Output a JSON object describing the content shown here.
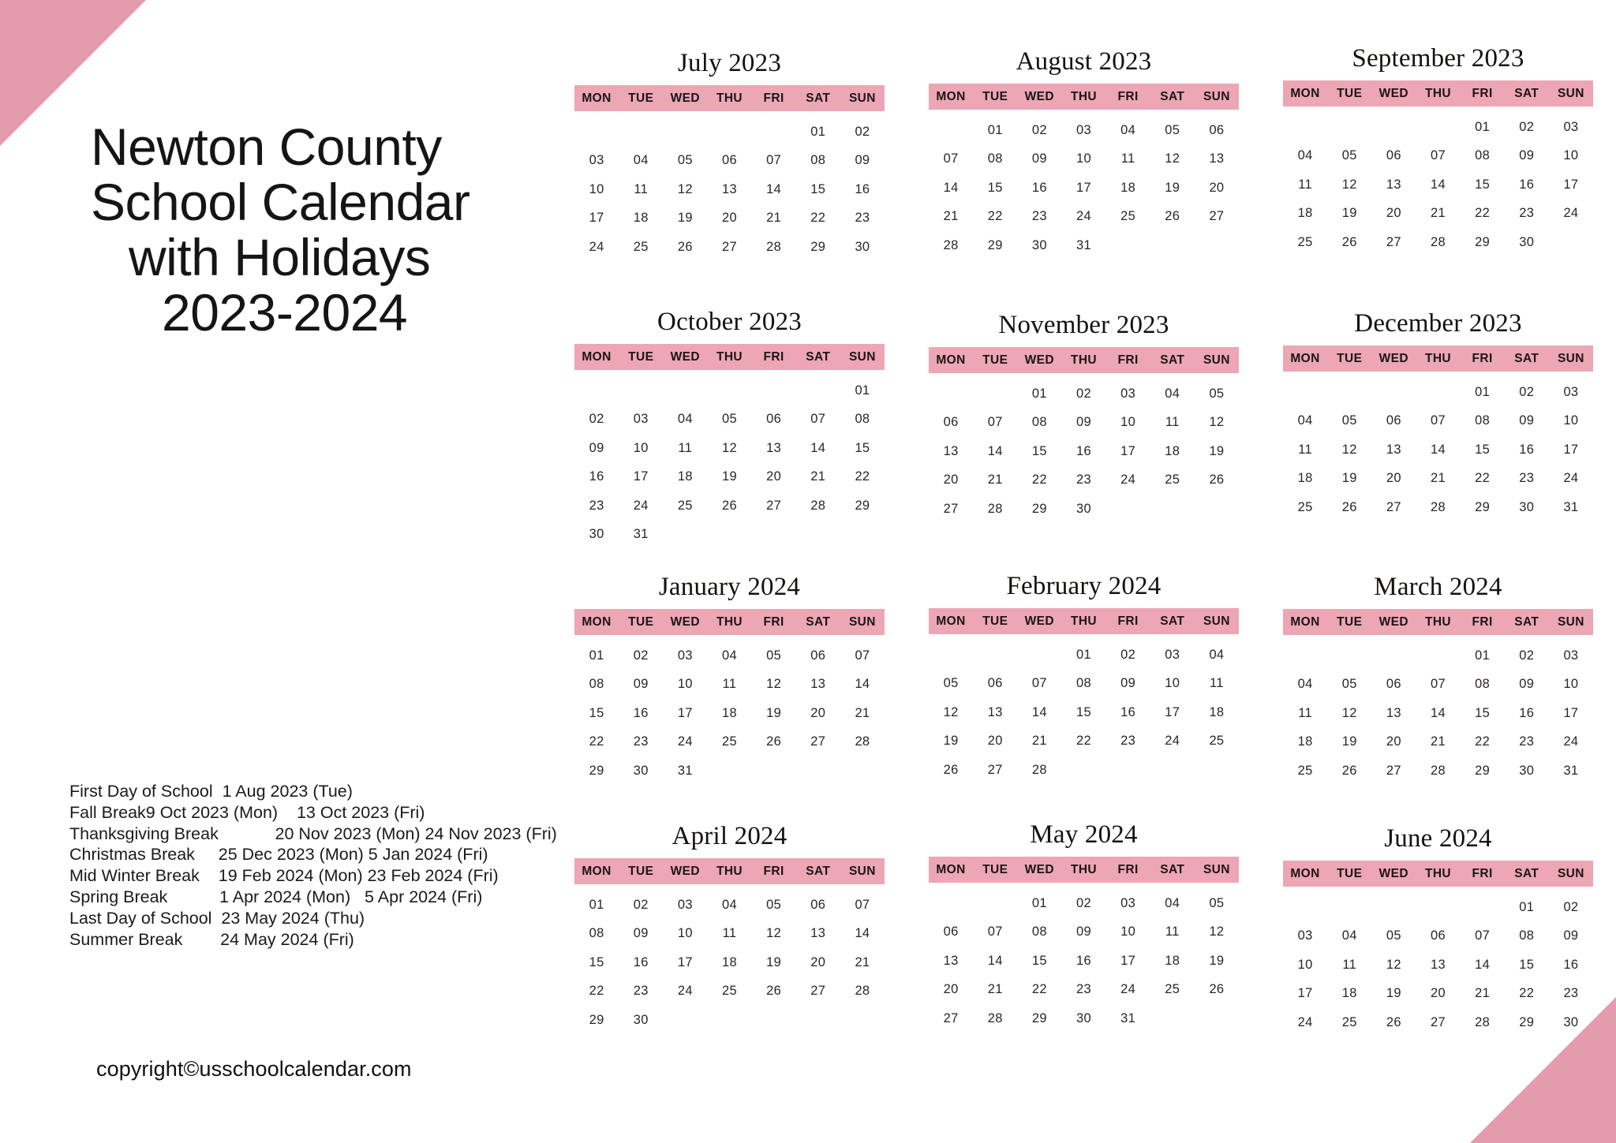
{
  "theme": {
    "accent_pink": "#e49bac",
    "header_pink": "#eda6b4",
    "text_dark": "#151515",
    "background": "#ffffff"
  },
  "title": {
    "line1": "Newton County",
    "line2": "School Calendar",
    "line3": "with Holidays",
    "line4": "2023-2024"
  },
  "holidays": [
    "First Day of School  1 Aug 2023 (Tue)",
    "Fall Break9 Oct 2023 (Mon)    13 Oct 2023 (Fri)",
    "Thanksgiving Break            20 Nov 2023 (Mon) 24 Nov 2023 (Fri)",
    "Christmas Break     25 Dec 2023 (Mon) 5 Jan 2024 (Fri)",
    "Mid Winter Break    19 Feb 2024 (Mon) 23 Feb 2024 (Fri)",
    "Spring Break           1 Apr 2024 (Mon)   5 Apr 2024 (Fri)",
    "Last Day of School  23 May 2024 (Thu)",
    "Summer Break        24 May 2024 (Fri)"
  ],
  "copyright": "copyright©usschoolcalendar.com",
  "weekday_headers": [
    "MON",
    "TUE",
    "WED",
    "THU",
    "FRI",
    "SAT",
    "SUN"
  ],
  "months": [
    {
      "key": "jul",
      "title": "July 2023",
      "weeks": [
        [
          "",
          "",
          "",
          "",
          "",
          "01",
          "02"
        ],
        [
          "03",
          "04",
          "05",
          "06",
          "07",
          "08",
          "09"
        ],
        [
          "10",
          "11",
          "12",
          "13",
          "14",
          "15",
          "16"
        ],
        [
          "17",
          "18",
          "19",
          "20",
          "21",
          "22",
          "23"
        ],
        [
          "24",
          "25",
          "26",
          "27",
          "28",
          "29",
          "30"
        ]
      ]
    },
    {
      "key": "aug",
      "title": "August 2023",
      "weeks": [
        [
          "",
          "01",
          "02",
          "03",
          "04",
          "05",
          "06"
        ],
        [
          "07",
          "08",
          "09",
          "10",
          "11",
          "12",
          "13"
        ],
        [
          "14",
          "15",
          "16",
          "17",
          "18",
          "19",
          "20"
        ],
        [
          "21",
          "22",
          "23",
          "24",
          "25",
          "26",
          "27"
        ],
        [
          "28",
          "29",
          "30",
          "31",
          "",
          "",
          ""
        ]
      ]
    },
    {
      "key": "sep",
      "title": "September 2023",
      "weeks": [
        [
          "",
          "",
          "",
          "",
          "01",
          "02",
          "03"
        ],
        [
          "04",
          "05",
          "06",
          "07",
          "08",
          "09",
          "10"
        ],
        [
          "11",
          "12",
          "13",
          "14",
          "15",
          "16",
          "17"
        ],
        [
          "18",
          "19",
          "20",
          "21",
          "22",
          "23",
          "24"
        ],
        [
          "25",
          "26",
          "27",
          "28",
          "29",
          "30",
          ""
        ]
      ]
    },
    {
      "key": "oct",
      "title": "October 2023",
      "weeks": [
        [
          "",
          "",
          "",
          "",
          "",
          "",
          "01"
        ],
        [
          "02",
          "03",
          "04",
          "05",
          "06",
          "07",
          "08"
        ],
        [
          "09",
          "10",
          "11",
          "12",
          "13",
          "14",
          "15"
        ],
        [
          "16",
          "17",
          "18",
          "19",
          "20",
          "21",
          "22"
        ],
        [
          "23",
          "24",
          "25",
          "26",
          "27",
          "28",
          "29"
        ],
        [
          "30",
          "31",
          "",
          "",
          "",
          "",
          ""
        ]
      ]
    },
    {
      "key": "nov",
      "title": "November 2023",
      "weeks": [
        [
          "",
          "",
          "01",
          "02",
          "03",
          "04",
          "05"
        ],
        [
          "06",
          "07",
          "08",
          "09",
          "10",
          "11",
          "12"
        ],
        [
          "13",
          "14",
          "15",
          "16",
          "17",
          "18",
          "19"
        ],
        [
          "20",
          "21",
          "22",
          "23",
          "24",
          "25",
          "26"
        ],
        [
          "27",
          "28",
          "29",
          "30",
          "",
          "",
          ""
        ]
      ]
    },
    {
      "key": "dec",
      "title": "December 2023",
      "weeks": [
        [
          "",
          "",
          "",
          "",
          "01",
          "02",
          "03"
        ],
        [
          "04",
          "05",
          "06",
          "07",
          "08",
          "09",
          "10"
        ],
        [
          "11",
          "12",
          "13",
          "14",
          "15",
          "16",
          "17"
        ],
        [
          "18",
          "19",
          "20",
          "21",
          "22",
          "23",
          "24"
        ],
        [
          "25",
          "26",
          "27",
          "28",
          "29",
          "30",
          "31"
        ]
      ]
    },
    {
      "key": "jan",
      "title": "January 2024",
      "weeks": [
        [
          "01",
          "02",
          "03",
          "04",
          "05",
          "06",
          "07"
        ],
        [
          "08",
          "09",
          "10",
          "11",
          "12",
          "13",
          "14"
        ],
        [
          "15",
          "16",
          "17",
          "18",
          "19",
          "20",
          "21"
        ],
        [
          "22",
          "23",
          "24",
          "25",
          "26",
          "27",
          "28"
        ],
        [
          "29",
          "30",
          "31",
          "",
          "",
          "",
          ""
        ]
      ]
    },
    {
      "key": "feb",
      "title": "February 2024",
      "weeks": [
        [
          "",
          "",
          "",
          "01",
          "02",
          "03",
          "04"
        ],
        [
          "05",
          "06",
          "07",
          "08",
          "09",
          "10",
          "11"
        ],
        [
          "12",
          "13",
          "14",
          "15",
          "16",
          "17",
          "18"
        ],
        [
          "19",
          "20",
          "21",
          "22",
          "23",
          "24",
          "25"
        ],
        [
          "26",
          "27",
          "28",
          "",
          "",
          "",
          ""
        ]
      ]
    },
    {
      "key": "mar",
      "title": "March 2024",
      "weeks": [
        [
          "",
          "",
          "",
          "",
          "01",
          "02",
          "03"
        ],
        [
          "04",
          "05",
          "06",
          "07",
          "08",
          "09",
          "10"
        ],
        [
          "11",
          "12",
          "13",
          "14",
          "15",
          "16",
          "17"
        ],
        [
          "18",
          "19",
          "20",
          "21",
          "22",
          "23",
          "24"
        ],
        [
          "25",
          "26",
          "27",
          "28",
          "29",
          "30",
          "31"
        ]
      ]
    },
    {
      "key": "apr",
      "title": "April 2024",
      "weeks": [
        [
          "01",
          "02",
          "03",
          "04",
          "05",
          "06",
          "07"
        ],
        [
          "08",
          "09",
          "10",
          "11",
          "12",
          "13",
          "14"
        ],
        [
          "15",
          "16",
          "17",
          "18",
          "19",
          "20",
          "21"
        ],
        [
          "22",
          "23",
          "24",
          "25",
          "26",
          "27",
          "28"
        ],
        [
          "29",
          "30",
          "",
          "",
          "",
          "",
          ""
        ]
      ]
    },
    {
      "key": "may",
      "title": "May 2024",
      "weeks": [
        [
          "",
          "",
          "01",
          "02",
          "03",
          "04",
          "05"
        ],
        [
          "06",
          "07",
          "08",
          "09",
          "10",
          "11",
          "12"
        ],
        [
          "13",
          "14",
          "15",
          "16",
          "17",
          "18",
          "19"
        ],
        [
          "20",
          "21",
          "22",
          "23",
          "24",
          "25",
          "26"
        ],
        [
          "27",
          "28",
          "29",
          "30",
          "31",
          "",
          ""
        ]
      ]
    },
    {
      "key": "jun",
      "title": "June 2024",
      "weeks": [
        [
          "",
          "",
          "",
          "",
          "",
          "01",
          "02"
        ],
        [
          "03",
          "04",
          "05",
          "06",
          "07",
          "08",
          "09"
        ],
        [
          "10",
          "11",
          "12",
          "13",
          "14",
          "15",
          "16"
        ],
        [
          "17",
          "18",
          "19",
          "20",
          "21",
          "22",
          "23"
        ],
        [
          "24",
          "25",
          "26",
          "27",
          "28",
          "29",
          "30"
        ]
      ]
    }
  ]
}
